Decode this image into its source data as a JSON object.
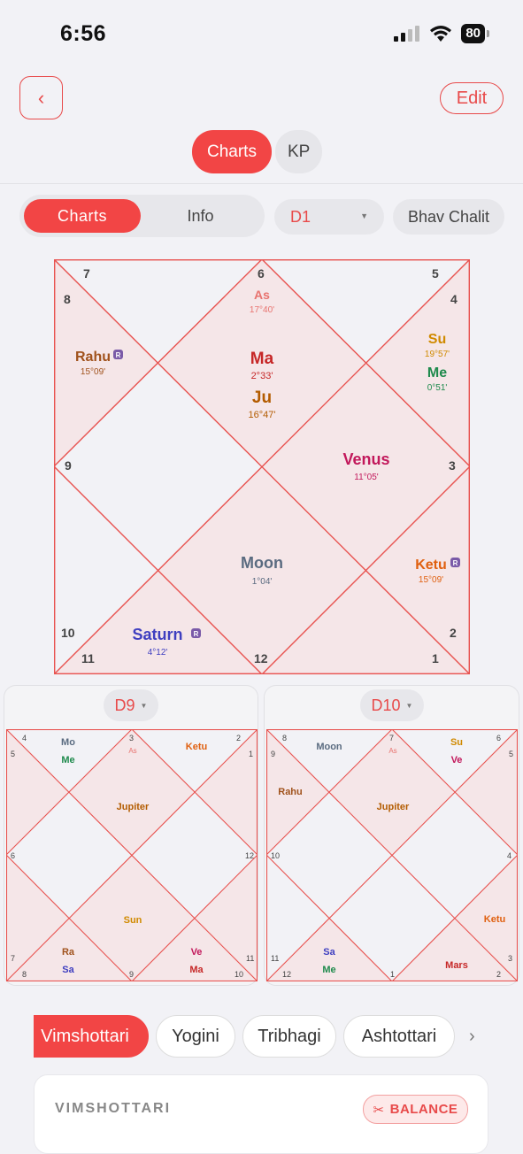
{
  "status_bar": {
    "time": "6:56",
    "battery": "80"
  },
  "header": {
    "edit_label": "Edit",
    "back_icon": "chevron-left-icon"
  },
  "top_segment": {
    "charts": "Charts",
    "kp": "KP"
  },
  "sub_segment": {
    "charts": "Charts",
    "info": "Info"
  },
  "chart_select": {
    "value": "D1"
  },
  "bhav_chalit": "Bhav Chalit",
  "d1": {
    "houses": [
      "7",
      "8",
      "6",
      "5",
      "4",
      "9",
      "3",
      "10",
      "2",
      "11",
      "12",
      "1"
    ],
    "planets": [
      {
        "name": "As",
        "deg": "17°40'",
        "color": "#e8736f"
      },
      {
        "name": "Ma",
        "deg": "2°33'",
        "color": "#c62828"
      },
      {
        "name": "Ju",
        "deg": "16°47'",
        "color": "#b35c00"
      },
      {
        "name": "Rahu",
        "deg": "15°09'",
        "color": "#a0521c",
        "retro": "R"
      },
      {
        "name": "Su",
        "deg": "19°57'",
        "color": "#d08a00"
      },
      {
        "name": "Me",
        "deg": "0°51'",
        "color": "#1e8a4c"
      },
      {
        "name": "Venus",
        "deg": "11°05'",
        "color": "#c2185b"
      },
      {
        "name": "Moon",
        "deg": "1°04'",
        "color": "#5a6b80"
      },
      {
        "name": "Ketu",
        "deg": "15°09'",
        "color": "#e06010",
        "retro": "R"
      },
      {
        "name": "Saturn",
        "deg": "4°12'",
        "color": "#3f3fc0",
        "retro": "R"
      }
    ],
    "retro_label": "R"
  },
  "d9": {
    "select": "D9",
    "houses": [
      "4",
      "3",
      "2",
      "5",
      "1",
      "6",
      "12",
      "7",
      "11",
      "8",
      "9",
      "10"
    ],
    "labels": {
      "mo": "Mo",
      "me": "Me",
      "as": "As",
      "ketu": "Ketu",
      "jupiter": "Jupiter",
      "sun": "Sun",
      "ra": "Ra",
      "sa": "Sa",
      "ve": "Ve",
      "ma": "Ma"
    }
  },
  "d10": {
    "select": "D10",
    "houses": [
      "8",
      "7",
      "6",
      "9",
      "5",
      "10",
      "4",
      "11",
      "3",
      "12",
      "1",
      "2"
    ],
    "labels": {
      "moon": "Moon",
      "as": "As",
      "su": "Su",
      "ve": "Ve",
      "rahu": "Rahu",
      "jupiter": "Jupiter",
      "ketu": "Ketu",
      "sa": "Sa",
      "me": "Me",
      "mars": "Mars"
    }
  },
  "dasha_tabs": [
    "Vimshottari",
    "Yogini",
    "Tribhagi",
    "Ashtottari"
  ],
  "vimshottari_card": {
    "title": "VIMSHOTTARI",
    "balance": "BALANCE"
  },
  "colors": {
    "accent": "#f24545",
    "line": "#e8524f",
    "fill": "#f5e6e8"
  }
}
